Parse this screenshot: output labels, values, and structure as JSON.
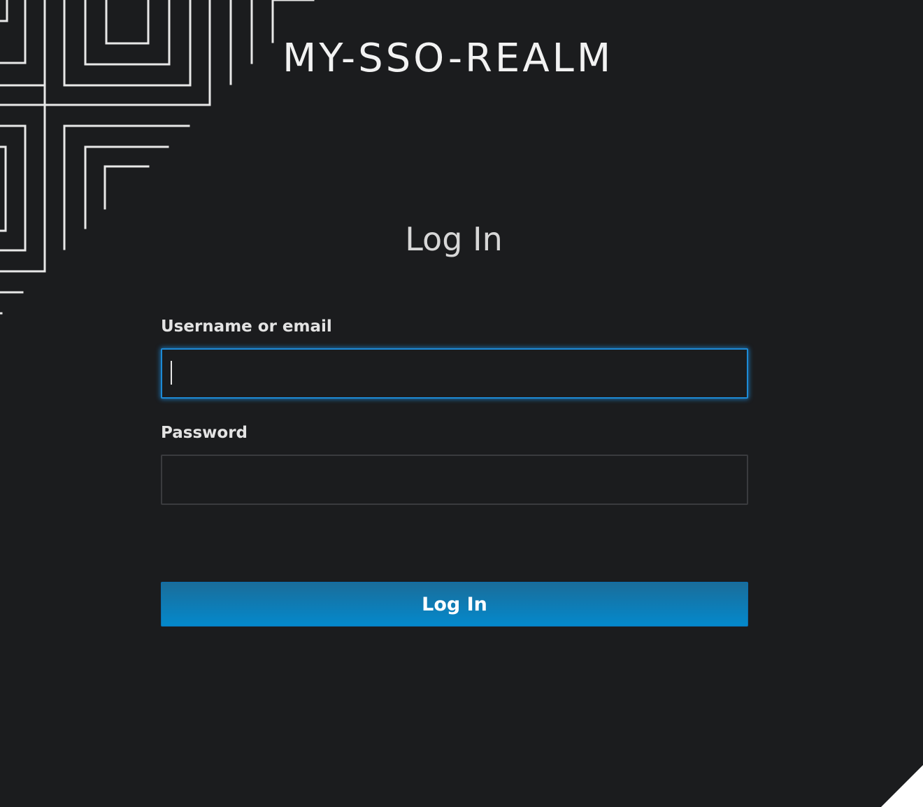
{
  "header": {
    "realm_name": "MY-SSO-REALM"
  },
  "login": {
    "heading": "Log In",
    "username_label": "Username or email",
    "username_value": "",
    "password_label": "Password",
    "password_value": "",
    "submit_label": "Log In"
  },
  "decorations": {
    "background_pattern": "concentric-squares-pattern",
    "corner_shape": "triangle-corner"
  },
  "colors": {
    "background": "#1b1c1e",
    "accent": "#0489cc",
    "focus_border": "#1d8ad6"
  }
}
